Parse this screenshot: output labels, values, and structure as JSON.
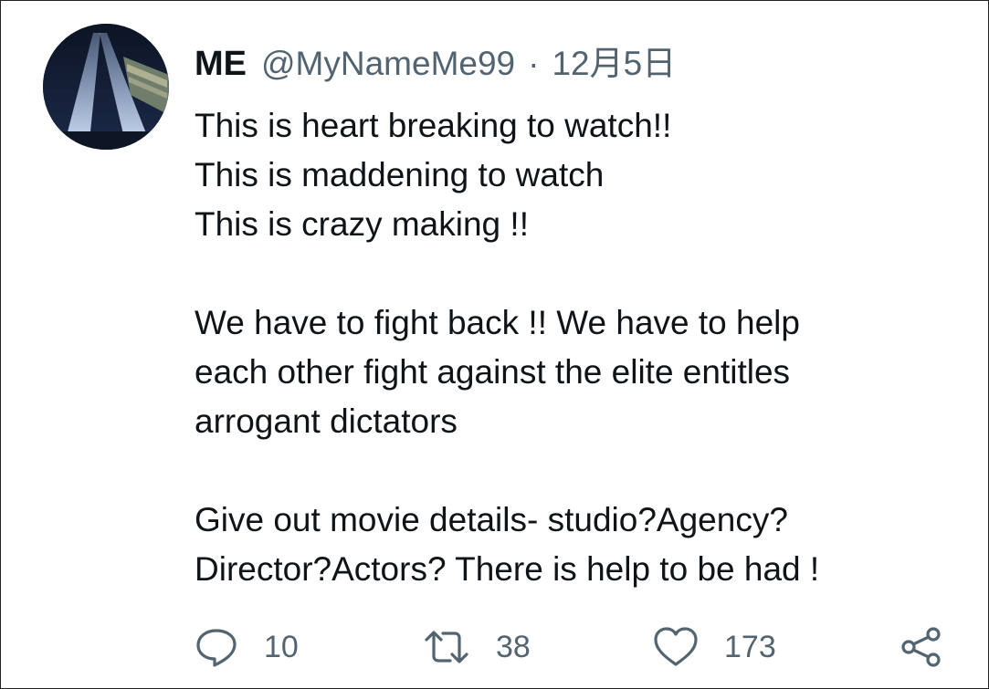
{
  "tweet": {
    "author_name": "ME",
    "handle": "@MyNameMe99",
    "separator": "·",
    "date": "12月5日",
    "body_lines": [
      "This is heart breaking to watch!!",
      "This is maddening to watch",
      "This is crazy making !!",
      "",
      "We have to fight back !! We have to help",
      "each other fight against the elite entitles",
      "arrogant dictators",
      "",
      "Give out movie details- studio?Agency?",
      "Director?Actors? There is help to be had !"
    ]
  },
  "actions": {
    "reply_icon": "reply-icon",
    "reply_count": "10",
    "retweet_icon": "retweet-icon",
    "retweet_count": "38",
    "like_icon": "heart-icon",
    "like_count": "173",
    "share_icon": "share-icon"
  },
  "colors": {
    "text_primary": "#0f1419",
    "text_secondary": "#536471",
    "border": "#222222"
  }
}
